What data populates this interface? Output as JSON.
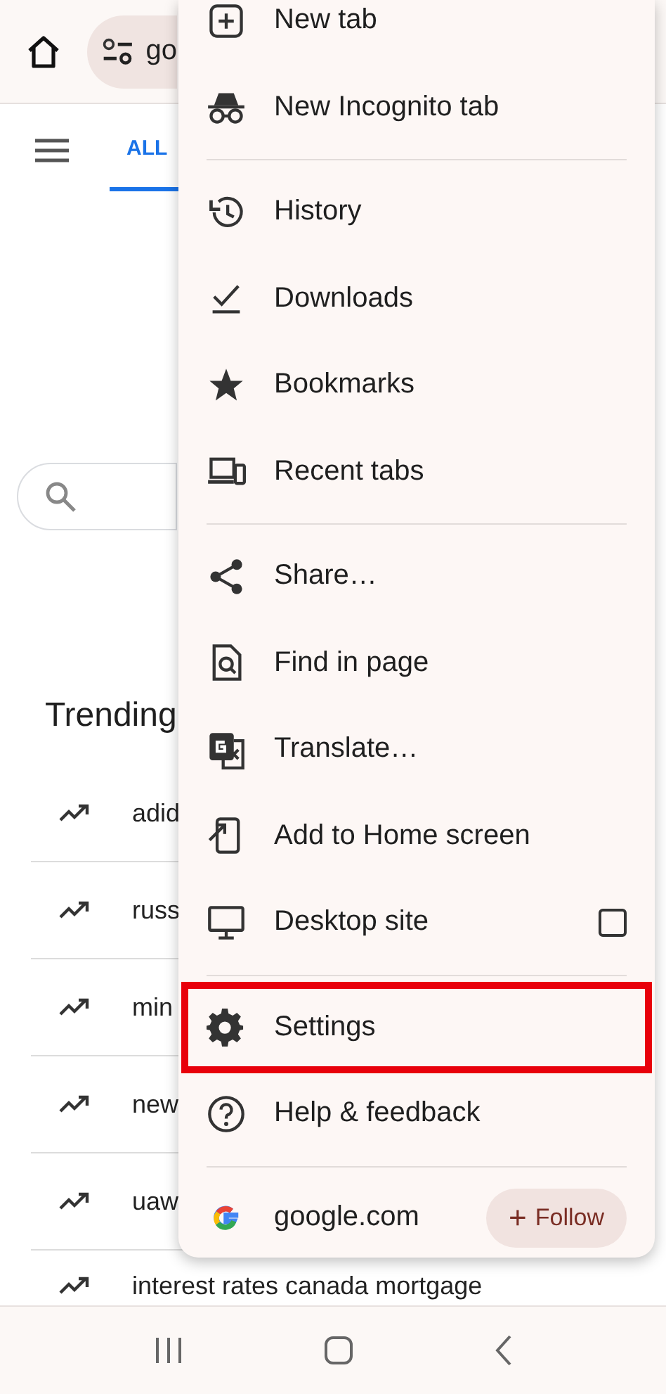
{
  "toolbar": {
    "url": "go"
  },
  "tabs": [
    {
      "label": "ALL",
      "selected": true
    }
  ],
  "trending": {
    "title": "Trending",
    "items": [
      {
        "text": "adid"
      },
      {
        "text": "russ"
      },
      {
        "text": "min"
      },
      {
        "text": "new"
      },
      {
        "text": "uaw"
      },
      {
        "text": "interest rates canada mortgage"
      }
    ]
  },
  "menu": {
    "items": [
      {
        "kind": "item",
        "label": "New tab",
        "highlighted": false
      },
      {
        "kind": "item",
        "label": "New Incognito tab",
        "highlighted": false
      },
      {
        "kind": "divider"
      },
      {
        "kind": "item",
        "label": "History",
        "highlighted": false
      },
      {
        "kind": "item",
        "label": "Downloads",
        "highlighted": false
      },
      {
        "kind": "item",
        "label": "Bookmarks",
        "highlighted": false
      },
      {
        "kind": "item",
        "label": "Recent tabs",
        "highlighted": false
      },
      {
        "kind": "divider"
      },
      {
        "kind": "item",
        "label": "Share…",
        "highlighted": false
      },
      {
        "kind": "item",
        "label": "Find in page",
        "highlighted": false
      },
      {
        "kind": "item",
        "label": "Translate…",
        "highlighted": false
      },
      {
        "kind": "item",
        "label": "Add to Home screen",
        "highlighted": false
      },
      {
        "kind": "checkbox",
        "label": "Desktop site",
        "checked": false,
        "highlighted": false
      },
      {
        "kind": "divider"
      },
      {
        "kind": "item",
        "label": "Settings",
        "highlighted": true
      },
      {
        "kind": "item",
        "label": "Help & feedback",
        "highlighted": false
      },
      {
        "kind": "divider"
      },
      {
        "kind": "site",
        "label": "google.com",
        "button": "Follow",
        "button_icon": "+"
      }
    ]
  }
}
